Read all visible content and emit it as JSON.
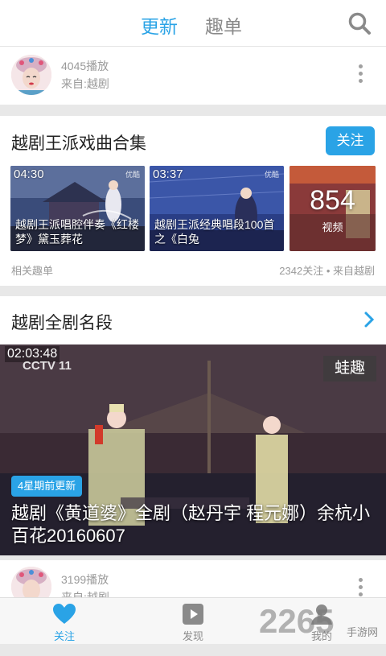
{
  "header": {
    "tab_active": "更新",
    "tab_inactive": "趣单",
    "search_icon": "search-icon",
    "accent_color": "#2aa3e6"
  },
  "post1": {
    "plays": "4045播放",
    "source": "来自:越剧"
  },
  "collection": {
    "title": "越剧王派戏曲合集",
    "follow_label": "关注",
    "thumbs": [
      {
        "duration": "04:30",
        "watermark": "优酷",
        "title": "越剧王派唱腔伴奏《红楼梦》黛玉葬花"
      },
      {
        "duration": "03:37",
        "watermark": "优酷",
        "title": "越剧王派经典唱段100首之《白兔"
      }
    ],
    "count": "854",
    "count_label": "视频",
    "meta_left": "相关趣单",
    "meta_right": "2342关注 • 来自越剧"
  },
  "section": {
    "title": "越剧全剧名段",
    "video": {
      "duration": "02:03:48",
      "channel_logo": "CCTV 11",
      "corner_logo": "蛙趣",
      "badge": "4星期前更新",
      "title": "越剧《黄道婆》全剧（赵丹宇 程元娜）余杭小百花20160607"
    }
  },
  "post2": {
    "plays": "3199播放",
    "source": "来自:越剧"
  },
  "nav": {
    "items": [
      {
        "label": "关注",
        "icon": "heart-icon"
      },
      {
        "label": "发现",
        "icon": "play-icon"
      },
      {
        "label": "我的",
        "icon": "user-icon"
      }
    ]
  },
  "watermark": {
    "number": "2265",
    "site": "手游网"
  }
}
